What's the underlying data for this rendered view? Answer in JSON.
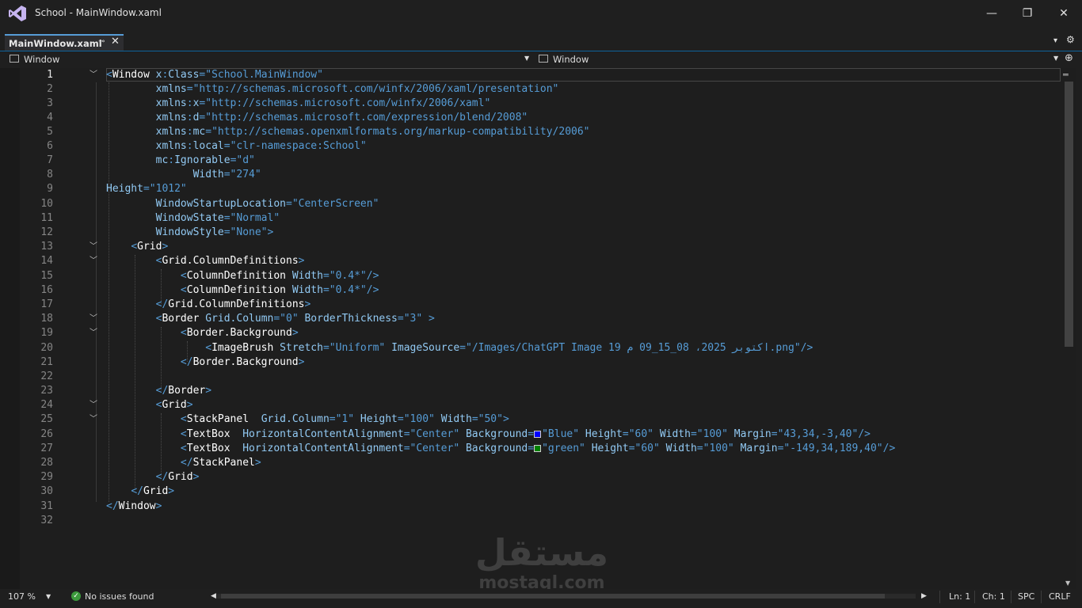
{
  "window": {
    "title": "School - MainWindow.xaml",
    "minimize": "—",
    "restore": "❐",
    "close": "✕"
  },
  "tab": {
    "label": "MainWindow.xaml",
    "pin": "⊸",
    "close": "✕",
    "overflow": "▾",
    "settings": "⚙"
  },
  "nav": {
    "left": "Window",
    "right": "Window",
    "split": "⊕"
  },
  "editor": {
    "line_numbers": [
      "1",
      "2",
      "3",
      "4",
      "5",
      "6",
      "7",
      "8",
      "9",
      "10",
      "11",
      "12",
      "13",
      "14",
      "15",
      "16",
      "17",
      "18",
      "19",
      "20",
      "21",
      "22",
      "23",
      "24",
      "25",
      "26",
      "27",
      "28",
      "29",
      "30",
      "31",
      "32"
    ],
    "current_line": 1,
    "swatch_colors": {
      "blue": "#0000ff",
      "green": "#008000"
    }
  },
  "status": {
    "zoom": "107 %",
    "issues": "No issues found",
    "ln": "Ln: 1",
    "ch": "Ch: 1",
    "spc": "SPC",
    "crlf": "CRLF"
  },
  "watermark": {
    "arabic": "مستقل",
    "latin": "mostaql.com"
  }
}
